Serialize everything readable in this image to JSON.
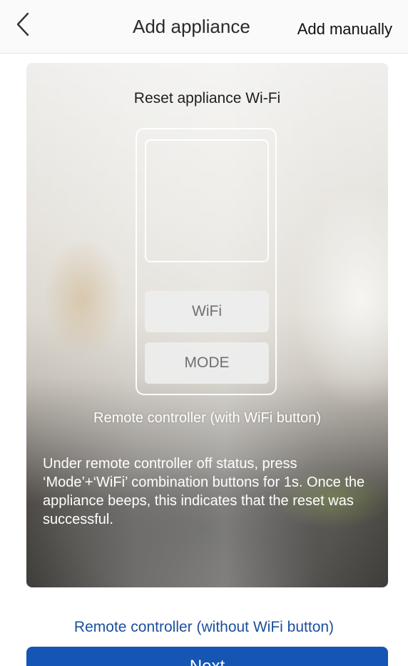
{
  "header": {
    "back_icon": "chevron-left-icon",
    "title": "Add appliance",
    "action_label": "Add manually"
  },
  "card": {
    "title": "Reset appliance Wi-Fi",
    "remote": {
      "wifi_button_label": "WiFi",
      "mode_button_label": "MODE"
    },
    "caption": "Remote controller (with WiFi button)",
    "instructions": "Under remote controller off status, press ‘Mode’+‘WiFi’ combination buttons for 1s. Once the appliance beeps, this indicates that the reset was successful."
  },
  "alternate_link": "Remote controller (without WiFi button)",
  "next_button": "Next",
  "colors": {
    "link": "#1c4f9c",
    "primary_button": "#1555b3"
  }
}
